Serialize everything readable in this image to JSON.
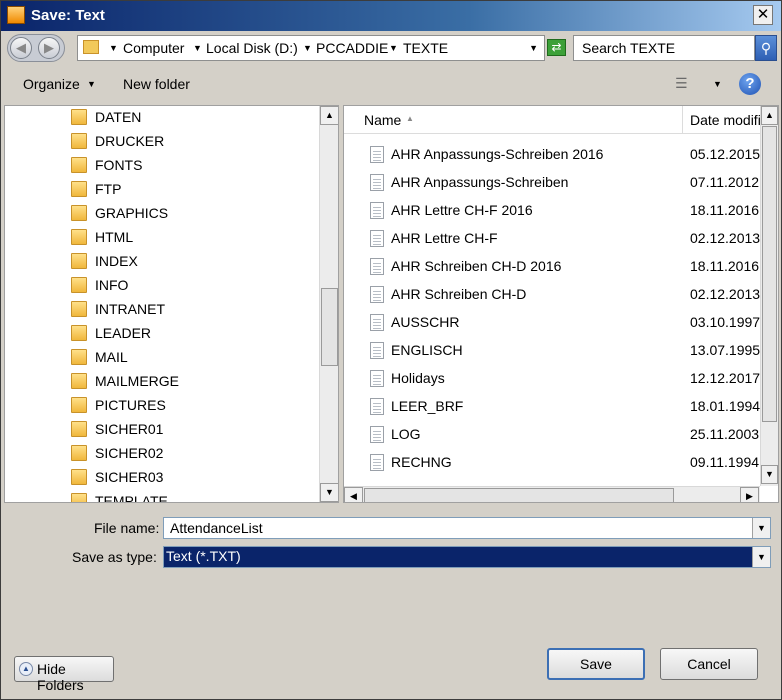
{
  "window": {
    "title": "Save: Text"
  },
  "address": {
    "crumbs": [
      "Computer",
      "Local Disk (D:)",
      "PCCADDIE",
      "TEXTE"
    ]
  },
  "search": {
    "placeholder": "Search TEXTE"
  },
  "toolbar": {
    "organize": "Organize",
    "new_folder": "New folder"
  },
  "tree": {
    "items": [
      "DATEN",
      "DRUCKER",
      "FONTS",
      "FTP",
      "GRAPHICS",
      "HTML",
      "INDEX",
      "INFO",
      "INTRANET",
      "LEADER",
      "MAIL",
      "MAILMERGE",
      "PICTURES",
      "SICHER01",
      "SICHER02",
      "SICHER03",
      "TEMPLATE"
    ]
  },
  "filelist": {
    "columns": {
      "name": "Name",
      "date": "Date modifi"
    },
    "files": [
      {
        "name": "AHR Anpassungs-Schreiben 2016",
        "date": "05.12.2015"
      },
      {
        "name": "AHR Anpassungs-Schreiben",
        "date": "07.11.2012"
      },
      {
        "name": "AHR Lettre CH-F 2016",
        "date": "18.11.2016"
      },
      {
        "name": "AHR Lettre CH-F",
        "date": "02.12.2013"
      },
      {
        "name": "AHR Schreiben CH-D 2016",
        "date": "18.11.2016"
      },
      {
        "name": "AHR Schreiben CH-D",
        "date": "02.12.2013"
      },
      {
        "name": "AUSSCHR",
        "date": "03.10.1997"
      },
      {
        "name": "ENGLISCH",
        "date": "13.07.1995"
      },
      {
        "name": "Holidays",
        "date": "12.12.2017"
      },
      {
        "name": "LEER_BRF",
        "date": "18.01.1994"
      },
      {
        "name": "LOG",
        "date": "25.11.2003"
      },
      {
        "name": "RECHNG",
        "date": "09.11.1994"
      }
    ]
  },
  "form": {
    "filename_label": "File name:",
    "filename_value": "AttendanceList",
    "type_label": "Save as type:",
    "type_value": "Text (*.TXT)"
  },
  "buttons": {
    "hide_folders": "Hide Folders",
    "save": "Save",
    "cancel": "Cancel"
  }
}
